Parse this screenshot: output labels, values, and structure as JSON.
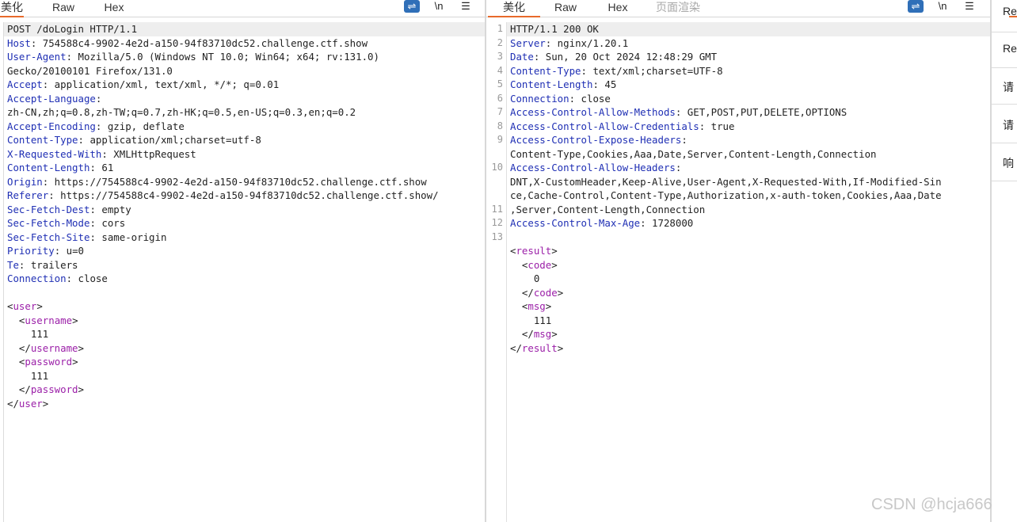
{
  "request": {
    "tabs": [
      "美化",
      "Raw",
      "Hex"
    ],
    "tools": [
      "\\n",
      "☰"
    ],
    "lines": [
      [
        [
          "POST /doLogin HTTP/1.1",
          "tx"
        ]
      ],
      [
        [
          "Host",
          "hk"
        ],
        [
          ": 754588c4-9902-4e2d-a150-94f83710dc52.challenge.ctf.show",
          "tx"
        ]
      ],
      [
        [
          "User-Agent",
          "hk"
        ],
        [
          ": Mozilla/5.0 (Windows NT 10.0; Win64; x64; rv:131.0)",
          "tx"
        ]
      ],
      [
        [
          "Gecko/20100101 Firefox/131.0",
          "tx"
        ]
      ],
      [
        [
          "Accept",
          "hk"
        ],
        [
          ": application/xml, text/xml, */*; q=0.01",
          "tx"
        ]
      ],
      [
        [
          "Accept-Language",
          "hk"
        ],
        [
          ":",
          "tx"
        ]
      ],
      [
        [
          "zh-CN,zh;q=0.8,zh-TW;q=0.7,zh-HK;q=0.5,en-US;q=0.3,en;q=0.2",
          "tx"
        ]
      ],
      [
        [
          "Accept-Encoding",
          "hk"
        ],
        [
          ": gzip, deflate",
          "tx"
        ]
      ],
      [
        [
          "Content-Type",
          "hk"
        ],
        [
          ": application/xml;charset=utf-8",
          "tx"
        ]
      ],
      [
        [
          "X-Requested-With",
          "hk"
        ],
        [
          ": XMLHttpRequest",
          "tx"
        ]
      ],
      [
        [
          "Content-Length",
          "hk"
        ],
        [
          ": 61",
          "tx"
        ]
      ],
      [
        [
          "Origin",
          "hk"
        ],
        [
          ": https://754588c4-9902-4e2d-a150-94f83710dc52.challenge.ctf.show",
          "tx"
        ]
      ],
      [
        [
          "Referer",
          "hk"
        ],
        [
          ": https://754588c4-9902-4e2d-a150-94f83710dc52.challenge.ctf.show/",
          "tx"
        ]
      ],
      [
        [
          "Sec-Fetch-Dest",
          "hk"
        ],
        [
          ": empty",
          "tx"
        ]
      ],
      [
        [
          "Sec-Fetch-Mode",
          "hk"
        ],
        [
          ": cors",
          "tx"
        ]
      ],
      [
        [
          "Sec-Fetch-Site",
          "hk"
        ],
        [
          ": same-origin",
          "tx"
        ]
      ],
      [
        [
          "Priority",
          "hk"
        ],
        [
          ": u=0",
          "tx"
        ]
      ],
      [
        [
          "Te",
          "hk"
        ],
        [
          ": trailers",
          "tx"
        ]
      ],
      [
        [
          "Connection",
          "hk"
        ],
        [
          ": close",
          "tx"
        ]
      ],
      [],
      [
        [
          "<",
          "tx"
        ],
        [
          "user",
          "tg"
        ],
        [
          ">",
          "tx"
        ]
      ],
      [
        [
          "  <",
          "tx"
        ],
        [
          "username",
          "tg"
        ],
        [
          ">",
          "tx"
        ]
      ],
      [
        [
          "    111",
          "tx"
        ]
      ],
      [
        [
          "  </",
          "tx"
        ],
        [
          "username",
          "tg"
        ],
        [
          ">",
          "tx"
        ]
      ],
      [
        [
          "  <",
          "tx"
        ],
        [
          "password",
          "tg"
        ],
        [
          ">",
          "tx"
        ]
      ],
      [
        [
          "    111",
          "tx"
        ]
      ],
      [
        [
          "  </",
          "tx"
        ],
        [
          "password",
          "tg"
        ],
        [
          ">",
          "tx"
        ]
      ],
      [
        [
          "</",
          "tx"
        ],
        [
          "user",
          "tg"
        ],
        [
          ">",
          "tx"
        ]
      ]
    ]
  },
  "response": {
    "tabs": [
      "美化",
      "Raw",
      "Hex",
      "页面渲染"
    ],
    "tools": [
      "\\n",
      "☰"
    ],
    "line_numbers": [
      "1",
      "2",
      "3",
      "4",
      "5",
      "6",
      "7",
      "8",
      "9",
      "",
      "10",
      "",
      "",
      "11",
      "12",
      "13",
      "",
      "",
      "",
      "",
      "",
      "",
      ""
    ],
    "lines": [
      [
        [
          "HTTP/1.1 200 OK",
          "tx"
        ]
      ],
      [
        [
          "Server",
          "hk"
        ],
        [
          ": nginx/1.20.1",
          "tx"
        ]
      ],
      [
        [
          "Date",
          "hk"
        ],
        [
          ": Sun, 20 Oct 2024 12:48:29 GMT",
          "tx"
        ]
      ],
      [
        [
          "Content-Type",
          "hk"
        ],
        [
          ": text/xml;charset=UTF-8",
          "tx"
        ]
      ],
      [
        [
          "Content-Length",
          "hk"
        ],
        [
          ": 45",
          "tx"
        ]
      ],
      [
        [
          "Connection",
          "hk"
        ],
        [
          ": close",
          "tx"
        ]
      ],
      [
        [
          "Access-Control-Allow-Methods",
          "hk"
        ],
        [
          ": GET,POST,PUT,DELETE,OPTIONS",
          "tx"
        ]
      ],
      [
        [
          "Access-Control-Allow-Credentials",
          "hk"
        ],
        [
          ": true",
          "tx"
        ]
      ],
      [
        [
          "Access-Control-Expose-Headers",
          "hk"
        ],
        [
          ":",
          "tx"
        ]
      ],
      [
        [
          "Content-Type,Cookies,Aaa,Date,Server,Content-Length,Connection",
          "tx"
        ]
      ],
      [
        [
          "Access-Control-Allow-Headers",
          "hk"
        ],
        [
          ":",
          "tx"
        ]
      ],
      [
        [
          "DNT,X-CustomHeader,Keep-Alive,User-Agent,X-Requested-With,If-Modified-Sin",
          "tx"
        ]
      ],
      [
        [
          "ce,Cache-Control,Content-Type,Authorization,x-auth-token,Cookies,Aaa,Date",
          "tx"
        ]
      ],
      [
        [
          ",Server,Content-Length,Connection",
          "tx"
        ]
      ],
      [
        [
          "Access-Control-Max-Age",
          "hk"
        ],
        [
          ": 1728000",
          "tx"
        ]
      ],
      [],
      [
        [
          "<",
          "tx"
        ],
        [
          "result",
          "tg"
        ],
        [
          ">",
          "tx"
        ]
      ],
      [
        [
          "  <",
          "tx"
        ],
        [
          "code",
          "tg"
        ],
        [
          ">",
          "tx"
        ]
      ],
      [
        [
          "    0",
          "tx"
        ]
      ],
      [
        [
          "  </",
          "tx"
        ],
        [
          "code",
          "tg"
        ],
        [
          ">",
          "tx"
        ]
      ],
      [
        [
          "  <",
          "tx"
        ],
        [
          "msg",
          "tg"
        ],
        [
          ">",
          "tx"
        ]
      ],
      [
        [
          "    111",
          "tx"
        ]
      ],
      [
        [
          "  </",
          "tx"
        ],
        [
          "msg",
          "tg"
        ],
        [
          ">",
          "tx"
        ]
      ],
      [
        [
          "</",
          "tx"
        ],
        [
          "result",
          "tg"
        ],
        [
          ">",
          "tx"
        ]
      ]
    ]
  },
  "sidebar": {
    "items": [
      "Re",
      "Re",
      "请",
      "响"
    ]
  },
  "watermark": "CSDN @hcja666",
  "colors": {
    "header_key": "#1f2fb4",
    "xml_tag": "#9b1fa8",
    "active_tab_underline": "#e86a2b",
    "wrap_button": "#2f6fb8"
  }
}
